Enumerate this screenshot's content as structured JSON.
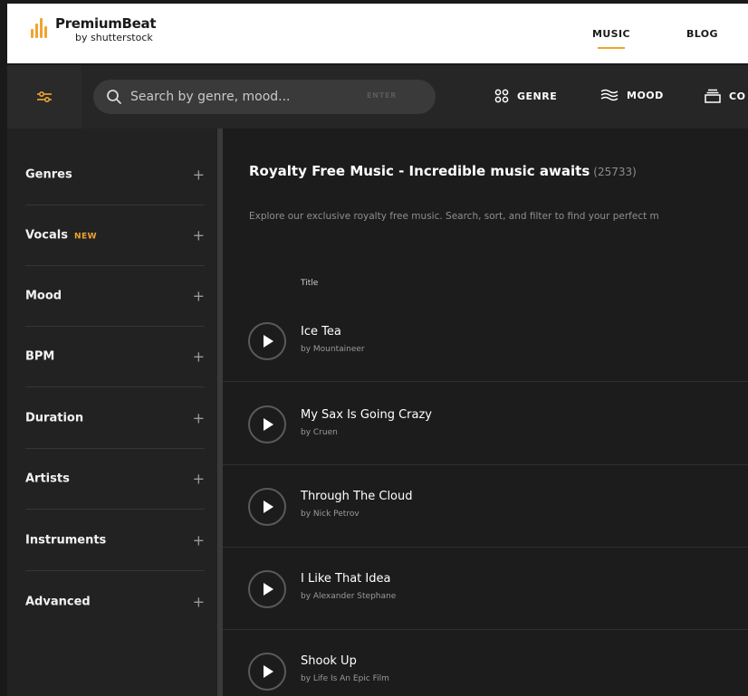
{
  "header": {
    "logo_title": "PremiumBeat",
    "logo_sub": "by shutterstock",
    "nav": [
      {
        "label": "MUSIC",
        "active": true
      },
      {
        "label": "BLOG",
        "active": false
      }
    ]
  },
  "toolbar": {
    "search_placeholder": "Search by genre, mood...",
    "search_enter": "ENTER",
    "genre_label": "GENRE",
    "mood_label": "MOOD",
    "collections_label": "CO"
  },
  "sidebar": {
    "items": [
      {
        "label": "Genres",
        "badge": ""
      },
      {
        "label": "Vocals",
        "badge": "NEW"
      },
      {
        "label": "Mood",
        "badge": ""
      },
      {
        "label": "BPM",
        "badge": ""
      },
      {
        "label": "Duration",
        "badge": ""
      },
      {
        "label": "Artists",
        "badge": ""
      },
      {
        "label": "Instruments",
        "badge": ""
      },
      {
        "label": "Advanced",
        "badge": ""
      }
    ],
    "expand_symbol": "+"
  },
  "main": {
    "title": "Royalty Free Music - Incredible music awaits",
    "count": "(25733)",
    "description": "Explore our exclusive royalty free music. Search, sort, and filter to find your perfect m",
    "column_title": "Title",
    "tracks": [
      {
        "title": "Ice Tea",
        "artist": "by Mountaineer"
      },
      {
        "title": "My Sax Is Going Crazy",
        "artist": "by Cruen"
      },
      {
        "title": "Through The Cloud",
        "artist": "by Nick Petrov"
      },
      {
        "title": "I Like That Idea",
        "artist": "by Alexander Stephane"
      },
      {
        "title": "Shook Up",
        "artist": "by Life Is An Epic Film"
      }
    ]
  },
  "colors": {
    "accent": "#f0a430",
    "background": "#1c1c1c",
    "sidebar": "#222222",
    "toolbar": "#262626"
  }
}
